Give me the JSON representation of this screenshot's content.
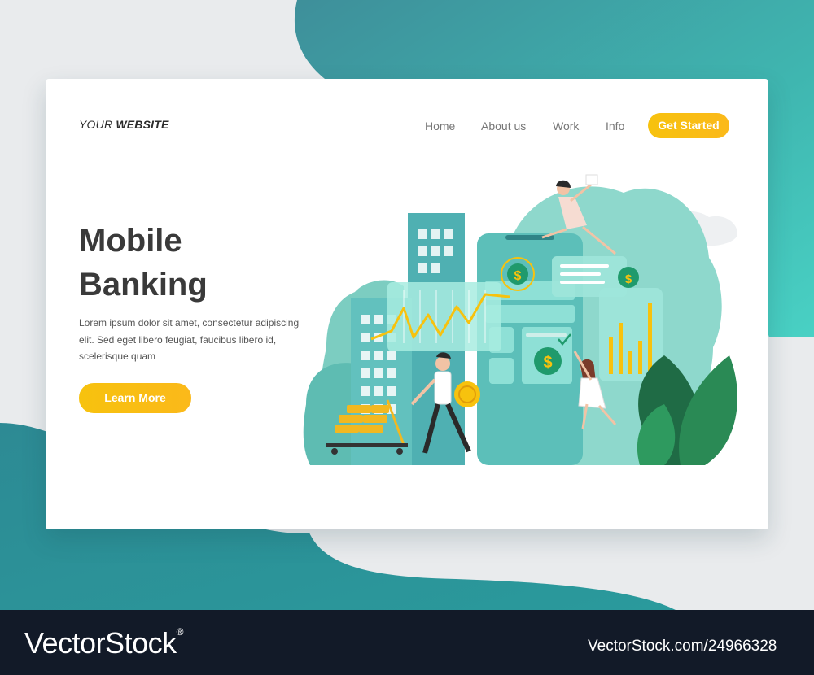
{
  "brand": {
    "prefix": "YOUR",
    "name": "WEBSITE"
  },
  "nav": {
    "items": [
      "Home",
      "About us",
      "Work",
      "Info"
    ],
    "cta_label": "Get Started"
  },
  "hero": {
    "title_line1": "Mobile",
    "title_line2": "Banking",
    "body": "Lorem ipsum dolor sit amet, consectetur adipiscing elit. Sed eget libero feugiat, faucibus libero id, scelerisque quam",
    "button_label": "Learn More"
  },
  "illustration": {
    "currency_symbol": "$"
  },
  "colors": {
    "teal_dark": "#2d8a94",
    "teal_light": "#7fd3c8",
    "accent_yellow": "#f7c20e",
    "leaf_green": "#1f6b45"
  },
  "watermark": {
    "brand": "VectorStock",
    "registered": "®",
    "id": "VectorStock.com/24966328"
  }
}
